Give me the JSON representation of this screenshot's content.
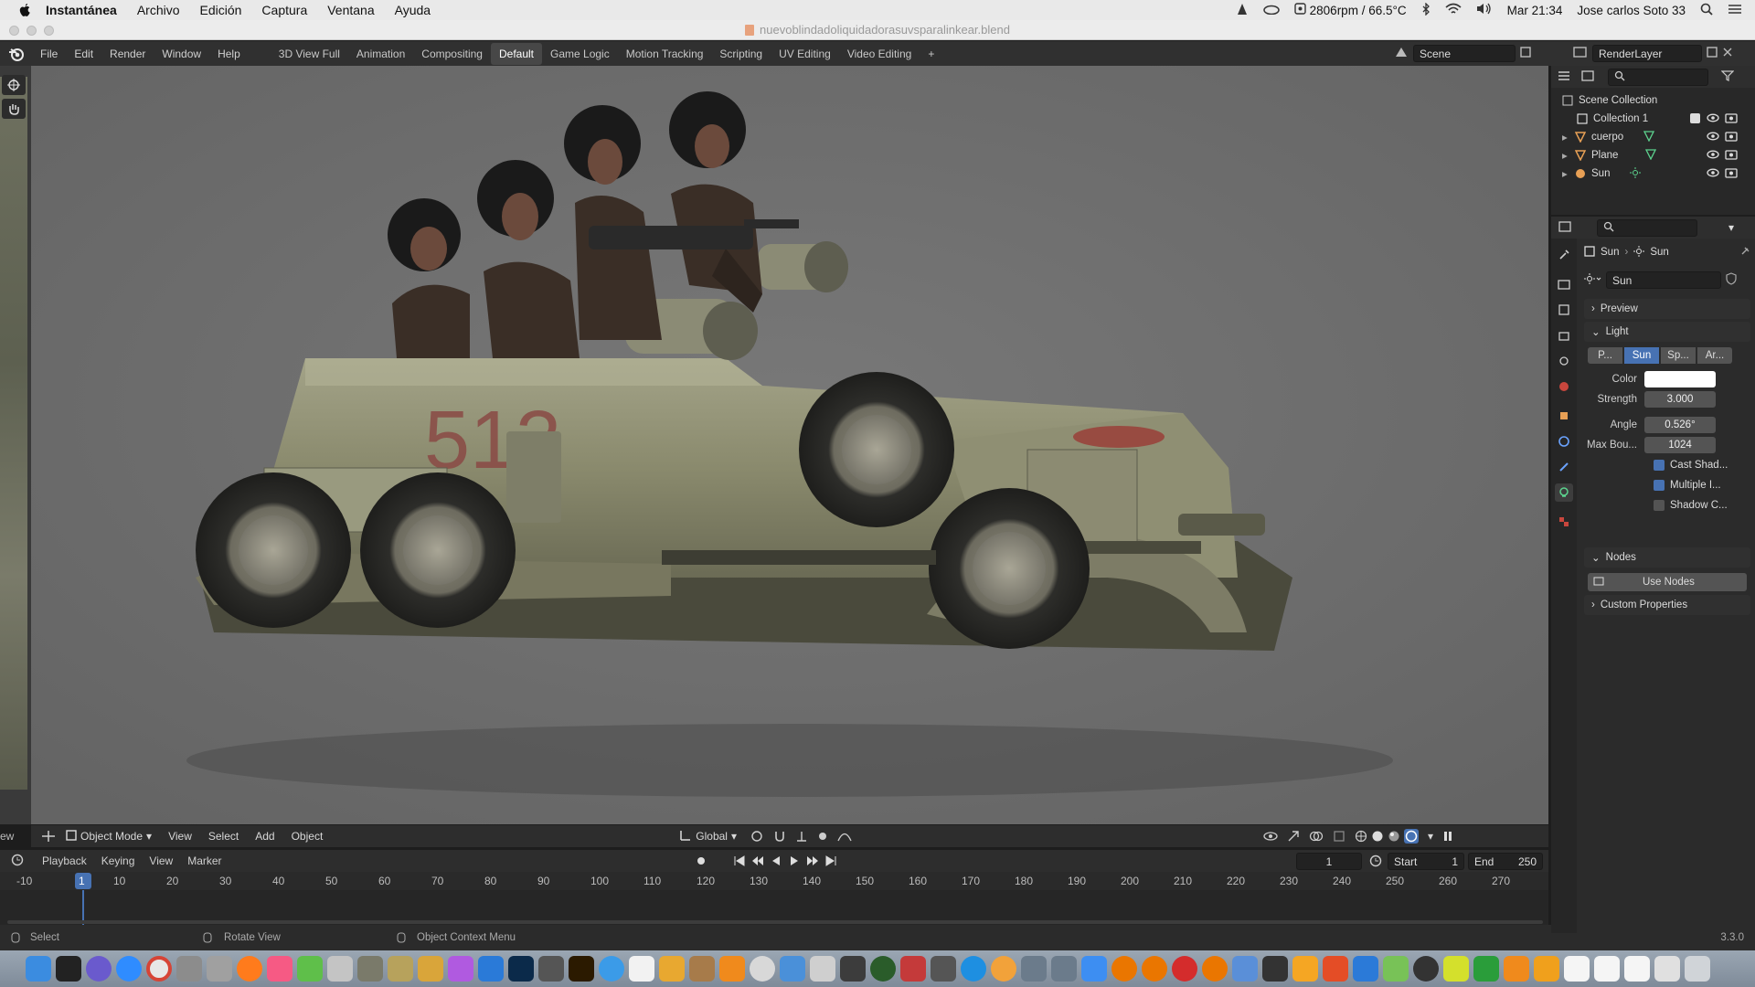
{
  "macbar": {
    "app_name": "Instantánea",
    "menus": [
      "Archivo",
      "Edición",
      "Captura",
      "Ventana",
      "Ayuda"
    ],
    "status_fan": "2806rpm / 66.5°C",
    "clock": "Mar 21:34",
    "user": "Jose carlos Soto 33"
  },
  "window": {
    "title": "nuevoblindadoliquidadorasuvsparalinkear.blend"
  },
  "topbar": {
    "menus": [
      "File",
      "Edit",
      "Render",
      "Window",
      "Help"
    ],
    "workspaces": [
      "3D View Full",
      "Animation",
      "Compositing",
      "Default",
      "Game Logic",
      "Motion Tracking",
      "Scripting",
      "UV Editing",
      "Video Editing",
      "+"
    ],
    "active_workspace": "Default",
    "scene": "Scene",
    "render_layer": "RenderLayer"
  },
  "viewport_header": {
    "mode": "Object Mode",
    "menus": [
      "View",
      "Select",
      "Add",
      "Object"
    ],
    "orientation": "Global",
    "left_edge_text": "ew"
  },
  "timeline": {
    "menus": [
      "Playback",
      "Keying",
      "View",
      "Marker"
    ],
    "current_frame": "1",
    "start_label": "Start",
    "start": "1",
    "end_label": "End",
    "end": "250",
    "ticks": [
      "-10",
      "1",
      "10",
      "20",
      "30",
      "40",
      "50",
      "60",
      "70",
      "80",
      "90",
      "100",
      "110",
      "120",
      "130",
      "140",
      "150",
      "160",
      "170",
      "180",
      "190",
      "200",
      "210",
      "220",
      "230",
      "240",
      "250",
      "260",
      "270"
    ]
  },
  "statusbar": {
    "select": "Select",
    "rotate": "Rotate View",
    "context": "Object Context Menu",
    "version": "3.3.0"
  },
  "outliner": {
    "root": "Scene Collection",
    "collection": "Collection 1",
    "items": [
      "cuerpo",
      "Plane",
      "Sun"
    ]
  },
  "properties": {
    "breadcrumb": [
      "Sun",
      "Sun"
    ],
    "datablock": "Sun",
    "panels": {
      "preview": "Preview",
      "light": "Light",
      "nodes": "Nodes",
      "custom": "Custom Properties",
      "use_nodes": "Use Nodes"
    },
    "light_types": [
      "P...",
      "Sun",
      "Sp...",
      "Ar..."
    ],
    "fields": {
      "color_label": "Color",
      "strength_label": "Strength",
      "strength": "3.000",
      "angle_label": "Angle",
      "angle": "0.526°",
      "max_bounces_label": "Max Bou...",
      "max_bounces": "1024"
    },
    "checkboxes": [
      {
        "label": "Cast Shad...",
        "checked": true
      },
      {
        "label": "Multiple I...",
        "checked": true
      },
      {
        "label": "Shadow C...",
        "checked": false
      }
    ]
  },
  "vehicle": {
    "number": "513"
  },
  "colors": {
    "accent": "#4772b3",
    "active_frame": "#4772b3",
    "viewport_bg": "#707070"
  }
}
